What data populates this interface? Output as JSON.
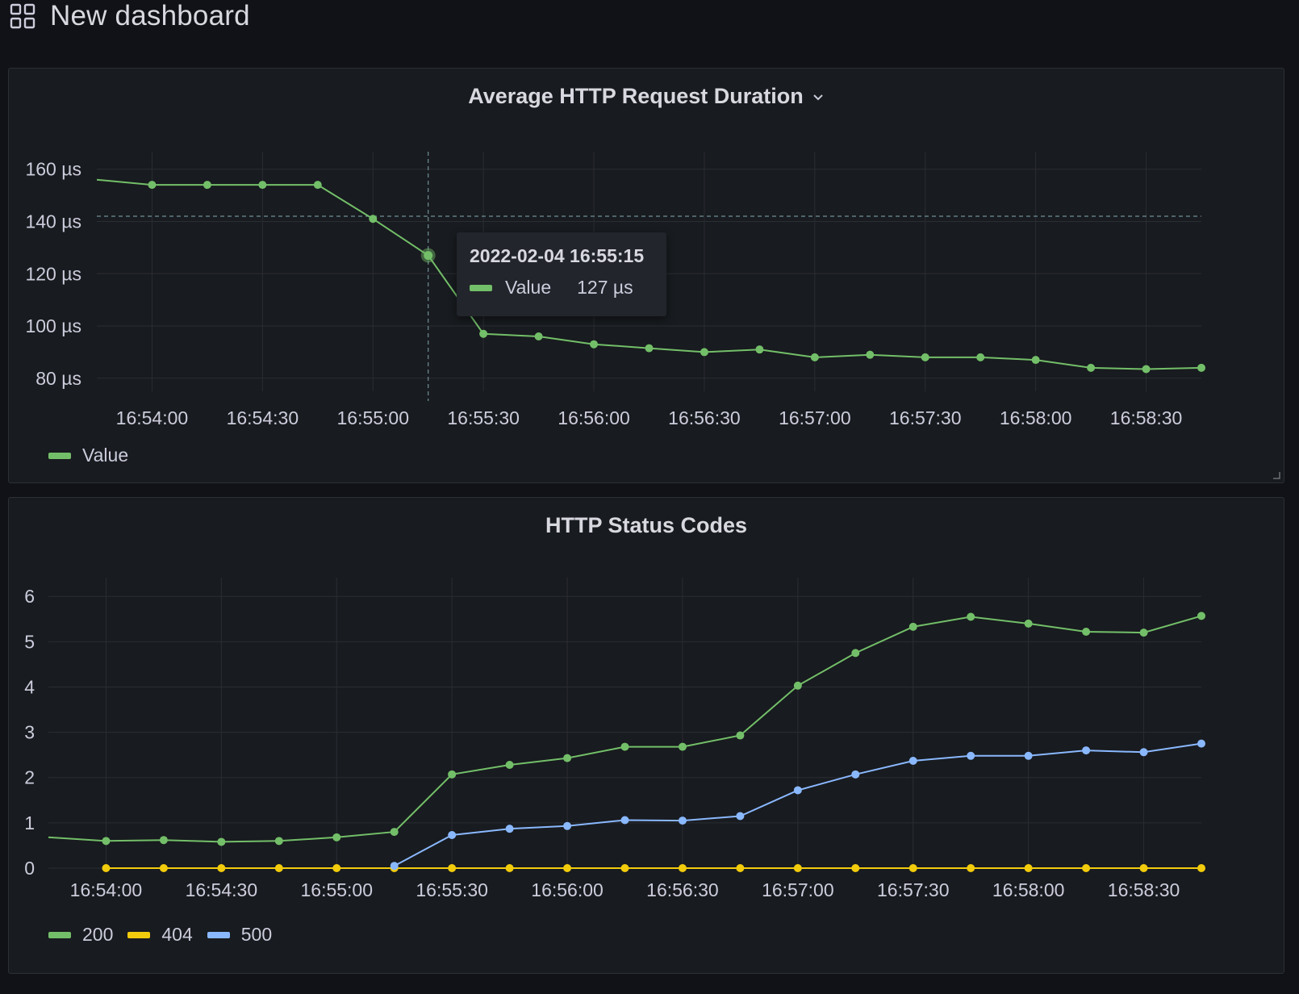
{
  "dashboard": {
    "title": "New dashboard"
  },
  "colors": {
    "green": "#73bf69",
    "yellow": "#f2cc0c",
    "blue": "#8ab8ff"
  },
  "panels": [
    {
      "title": "Average HTTP Request Duration"
    },
    {
      "title": "HTTP Status Codes"
    }
  ],
  "tooltip": {
    "time": "2022-02-04 16:55:15",
    "series": "Value",
    "value": "127 µs"
  },
  "chart_data": [
    {
      "type": "line",
      "title": "Average HTTP Request Duration",
      "xlabel": "",
      "ylabel": "",
      "unit": "µs",
      "ylim": [
        75,
        163
      ],
      "xlim": [
        "16:53:45",
        "16:58:45"
      ],
      "yticks": [
        "80 µs",
        "100 µs",
        "120 µs",
        "140 µs",
        "160 µs"
      ],
      "xticks": [
        "16:54:00",
        "16:54:30",
        "16:55:00",
        "16:55:30",
        "16:56:00",
        "16:56:30",
        "16:57:00",
        "16:57:30",
        "16:58:00",
        "16:58:30"
      ],
      "legend": "bottom-left",
      "grid": true,
      "x": [
        "16:53:45",
        "16:54:00",
        "16:54:15",
        "16:54:30",
        "16:54:45",
        "16:55:00",
        "16:55:15",
        "16:55:30",
        "16:55:45",
        "16:56:00",
        "16:56:15",
        "16:56:30",
        "16:56:45",
        "16:57:00",
        "16:57:15",
        "16:57:30",
        "16:57:45",
        "16:58:00",
        "16:58:15",
        "16:58:30",
        "16:58:45"
      ],
      "series": [
        {
          "name": "Value",
          "color": "#73bf69",
          "values": [
            156,
            154,
            154,
            154,
            154,
            141,
            127,
            97,
            96,
            93,
            91.5,
            90,
            91,
            88,
            89,
            88,
            88,
            87,
            84,
            83.5,
            84
          ]
        }
      ],
      "crosshair": {
        "x": "16:55:15",
        "y": 142
      }
    },
    {
      "type": "line",
      "title": "HTTP Status Codes",
      "xlabel": "",
      "ylabel": "",
      "ylim": [
        0,
        6.2
      ],
      "xlim": [
        "16:53:45",
        "16:58:45"
      ],
      "yticks": [
        "0",
        "1",
        "2",
        "3",
        "4",
        "5",
        "6"
      ],
      "xticks": [
        "16:54:00",
        "16:54:30",
        "16:55:00",
        "16:55:30",
        "16:56:00",
        "16:56:30",
        "16:57:00",
        "16:57:30",
        "16:58:00",
        "16:58:30"
      ],
      "legend": "bottom-left",
      "grid": true,
      "x": [
        "16:53:45",
        "16:54:00",
        "16:54:15",
        "16:54:30",
        "16:54:45",
        "16:55:00",
        "16:55:15",
        "16:55:30",
        "16:55:45",
        "16:56:00",
        "16:56:15",
        "16:56:30",
        "16:56:45",
        "16:57:00",
        "16:57:15",
        "16:57:30",
        "16:57:45",
        "16:58:00",
        "16:58:15",
        "16:58:30",
        "16:58:45"
      ],
      "series": [
        {
          "name": "200",
          "color": "#73bf69",
          "values": [
            0.68,
            0.6,
            0.62,
            0.58,
            0.6,
            0.68,
            0.8,
            2.07,
            2.28,
            2.43,
            2.68,
            2.68,
            2.93,
            4.03,
            4.75,
            5.33,
            5.55,
            5.4,
            5.22,
            5.2,
            5.57
          ]
        },
        {
          "name": "404",
          "color": "#f2cc0c",
          "values": [
            null,
            0,
            0,
            0,
            0,
            0,
            0,
            0,
            0,
            0,
            0,
            0,
            0,
            0,
            0,
            0,
            0,
            0,
            0,
            0,
            0
          ]
        },
        {
          "name": "500",
          "color": "#8ab8ff",
          "values": [
            null,
            null,
            null,
            null,
            null,
            null,
            0.05,
            0.73,
            0.87,
            0.93,
            1.06,
            1.05,
            1.15,
            1.72,
            2.07,
            2.37,
            2.48,
            2.48,
            2.6,
            2.56,
            2.75
          ]
        }
      ]
    }
  ]
}
